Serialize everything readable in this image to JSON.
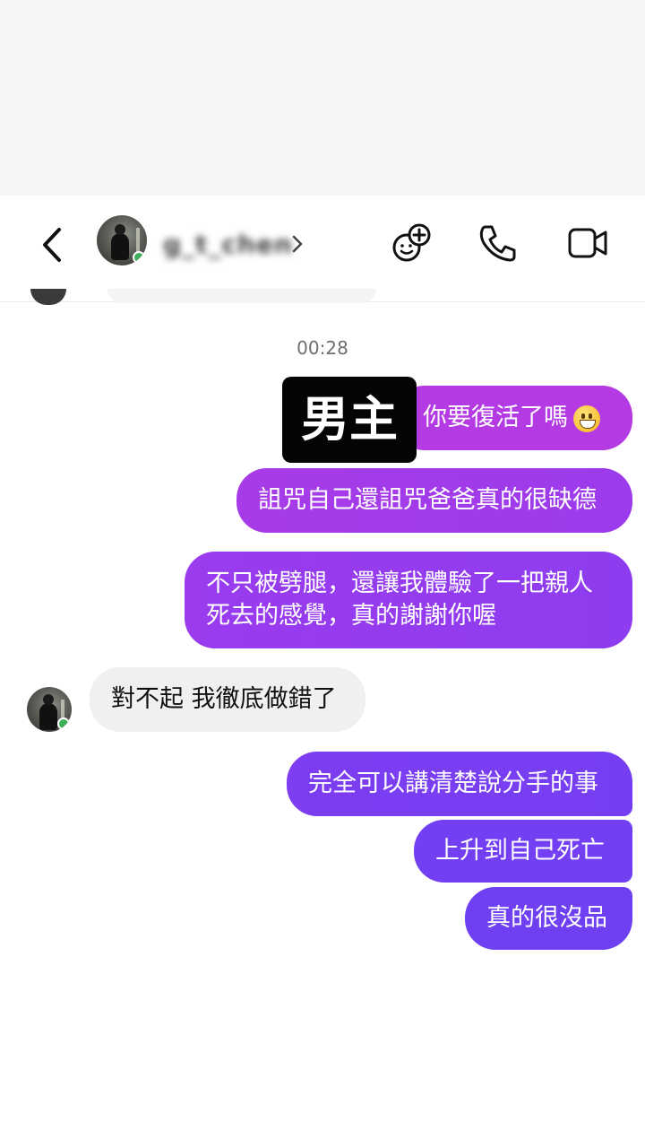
{
  "header": {
    "username": "g_t_chen",
    "back_icon": "chevron-left-icon",
    "actions": [
      "add-friend-avatars-icon",
      "phone-icon",
      "video-camera-icon"
    ]
  },
  "thread": {
    "timestamp": "00:28",
    "overlay_label": "男主",
    "messages": [
      {
        "from": "me",
        "text": "你要復活了嗎",
        "emoji": "grinning-face"
      },
      {
        "from": "me",
        "text": "詛咒自己還詛咒爸爸真的很缺德"
      },
      {
        "from": "me",
        "lines": [
          "不只被劈腿，還讓我體驗了一把親人",
          "死去的感覺，真的謝謝你喔"
        ]
      },
      {
        "from": "them",
        "text": "對不起 我徹底做錯了"
      },
      {
        "from": "me",
        "text": "完全可以講清楚說分手的事"
      },
      {
        "from": "me",
        "text": "上升到自己死亡"
      },
      {
        "from": "me",
        "text": "真的很沒品"
      }
    ]
  },
  "colors": {
    "bubble_top": "#b23be6",
    "bubble_mid": "#8a3bf0",
    "bubble_bottom": "#6e3ff2",
    "incoming_bubble": "#eef0f2"
  }
}
